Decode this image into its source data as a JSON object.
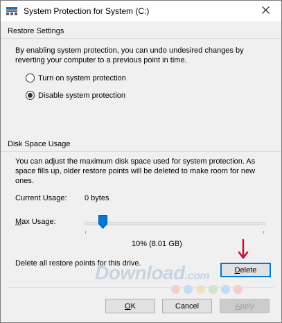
{
  "window": {
    "title": "System Protection for System (C:)"
  },
  "restore_settings": {
    "heading": "Restore Settings",
    "description": "By enabling system protection, you can undo undesired changes by reverting your computer to a previous point in time.",
    "options": [
      {
        "label": "Turn on system protection",
        "checked": false
      },
      {
        "label": "Disable system protection",
        "checked": true
      }
    ]
  },
  "disk_space": {
    "heading": "Disk Space Usage",
    "description": "You can adjust the maximum disk space used for system protection. As space fills up, older restore points will be deleted to make room for new ones.",
    "current_usage_label": "Current Usage:",
    "current_usage_value": "0 bytes",
    "max_usage_label": "Max Usage:",
    "max_usage_value": "10% (8.01 GB)",
    "max_usage_fraction": 0.1,
    "delete_text": "Delete all restore points for this drive.",
    "delete_button_label": "Delete"
  },
  "buttons": {
    "ok": "OK",
    "cancel": "Cancel",
    "apply": "Apply"
  },
  "watermark": {
    "text": "Download",
    "suffix": ".com"
  },
  "colors": {
    "accent": "#0078d7",
    "arrow": "#c8102e"
  }
}
